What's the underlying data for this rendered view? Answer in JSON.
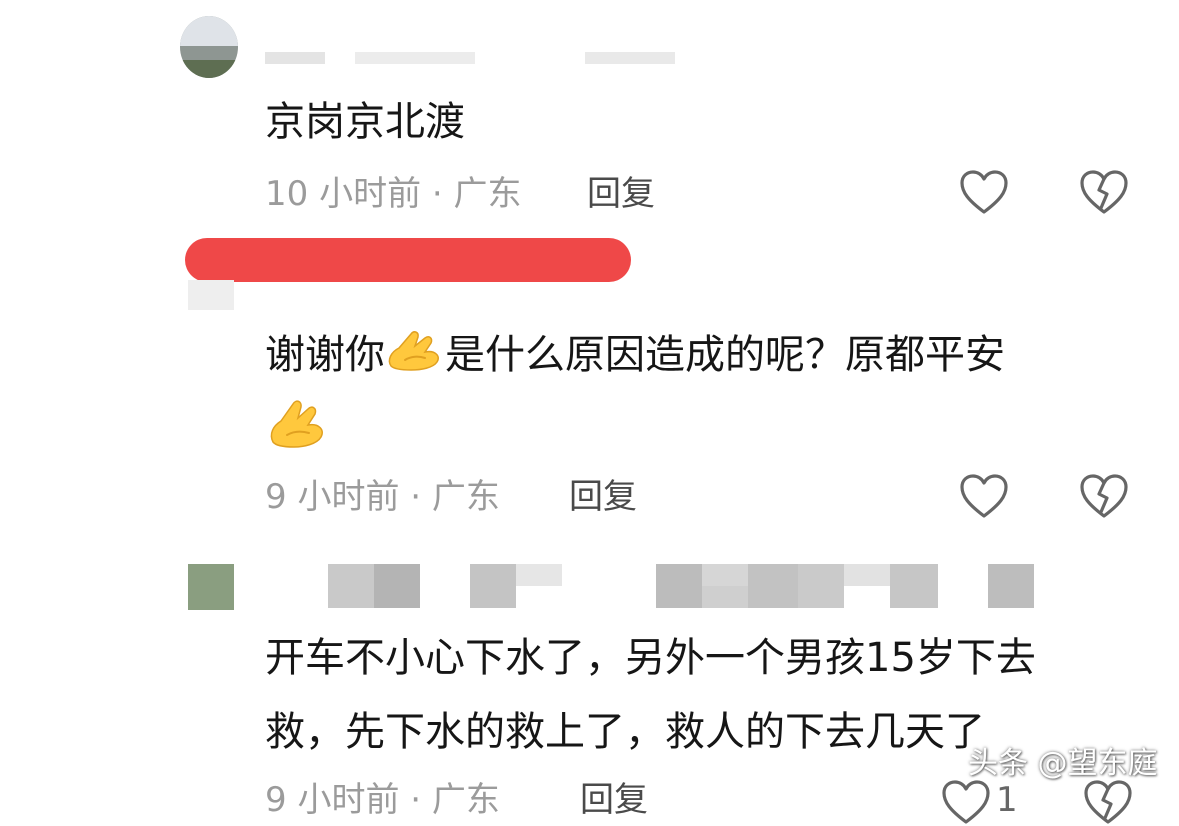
{
  "comments": [
    {
      "text": "京岗京北渡",
      "time": "10 小时前",
      "location": "广东",
      "reply": "回复"
    },
    {
      "text_before_emoji": "谢谢你",
      "text_after_emoji": "是什么原因造成的呢？原都平安",
      "emoji": "pinched-fingers-emoji",
      "time": "9 小时前",
      "location": "广东",
      "reply": "回复"
    },
    {
      "text_line1": "开车不小心下水了，另外一个男孩15岁下去",
      "text_line2": "救，先下水的救上了，救人的下去几天了",
      "time": "9 小时前",
      "location": "广东",
      "reply": "回复",
      "like_count": "1"
    }
  ],
  "separator": "·",
  "icons": {
    "like": "heart-outline-icon",
    "dislike": "broken-heart-icon"
  },
  "colors": {
    "redaction": "#ef4848",
    "meta_text": "#9b9b9b",
    "reply_text": "#4a4a4a",
    "icon": "#666666"
  },
  "watermark": "头条 @望东庭"
}
